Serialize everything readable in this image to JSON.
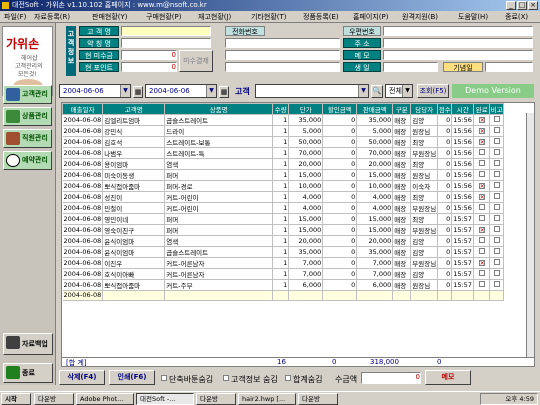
{
  "window": {
    "title": "대전Soft - 가위손 v1.10.102 홈페이지 : www.m@nsoft.co.kr"
  },
  "menu": [
    "파일(F)",
    "자료등록(R)",
    "판매현황(Y)",
    "구매현황(P)",
    "재고현황(J)",
    "기타현황(T)",
    "정품등록(E)",
    "홈페이지(P)",
    "원격지원(B)",
    "도움말(H)",
    "종료(X)"
  ],
  "sidebar": {
    "logo_title": "가위손",
    "logo_sub1": "헤어샵",
    "logo_sub2": "고객관리의",
    "logo_sub3": "모든것!",
    "items": [
      "고객관리",
      "상품관리",
      "직원관리",
      "예약관리"
    ],
    "backup": "자료백업",
    "exit": "종료"
  },
  "customer_panel": {
    "section_label": "고객정보",
    "labels": [
      "고 객 명",
      "약 칭 명",
      "현 미수금",
      "현 포인트"
    ],
    "values": [
      "",
      "",
      "0",
      "0"
    ],
    "settle_button": "미수결제",
    "phone_label": "전화번호",
    "right_labels": [
      "우편번호",
      "주 소",
      "메 모",
      "생 일"
    ],
    "anniv_label": "기념일"
  },
  "toolbar": {
    "date_from": "2004-06-06",
    "date_to": "2004-06-06",
    "customer_label": "고객",
    "customer_value": "",
    "filter_value": "전체",
    "search_button": "조회(F5)",
    "demo": "Demo Version"
  },
  "table": {
    "columns": [
      "매출일자",
      "고객명",
      "상품명",
      "수량",
      "단가",
      "할인금액",
      "판매금액",
      "구분",
      "담당자",
      "점수",
      "시간",
      "완료",
      "비고"
    ],
    "rows": [
      [
        "2004-06-08",
        "김엘리트엄마",
        "곱슬스트레이트",
        "1",
        "35,000",
        "0",
        "35,000",
        "매장",
        "김양",
        "0",
        "15:56",
        "x",
        ""
      ],
      [
        "2004-06-08",
        "강민식",
        "드라이",
        "1",
        "5,000",
        "0",
        "5,000",
        "매장",
        "원장님",
        "0",
        "15:56",
        "x",
        ""
      ],
      [
        "2004-06-08",
        "김호석",
        "스트레이트-보통",
        "1",
        "50,000",
        "0",
        "50,000",
        "매장",
        "최양",
        "0",
        "15:56",
        "x",
        ""
      ],
      [
        "2004-06-08",
        "나범우",
        "스트레이트-특",
        "1",
        "70,000",
        "0",
        "70,000",
        "매장",
        "부원장님",
        "0",
        "15:56",
        "",
        ""
      ],
      [
        "2004-06-08",
        "용이엄마",
        "염색",
        "1",
        "20,000",
        "0",
        "20,000",
        "매장",
        "최양",
        "0",
        "15:56",
        "",
        ""
      ],
      [
        "2004-06-08",
        "미숙이동생",
        "퍼머",
        "1",
        "15,000",
        "0",
        "15,000",
        "매장",
        "원장님",
        "0",
        "15:56",
        "",
        ""
      ],
      [
        "2004-06-08",
        "뽀식접아줌마",
        "퍼머-경로",
        "1",
        "10,000",
        "0",
        "10,000",
        "매장",
        "이숙자",
        "0",
        "15:56",
        "x",
        ""
      ],
      [
        "2004-06-08",
        "성진이",
        "커트-어린이",
        "1",
        "4,000",
        "0",
        "4,000",
        "매장",
        "최양",
        "0",
        "15:56",
        "x",
        ""
      ],
      [
        "2004-06-08",
        "민철이",
        "커트-어린이",
        "1",
        "4,000",
        "0",
        "4,000",
        "매장",
        "부원장님",
        "0",
        "15:56",
        "",
        ""
      ],
      [
        "2004-06-08",
        "영민이네",
        "퍼머",
        "1",
        "15,000",
        "0",
        "15,000",
        "매장",
        "최양",
        "0",
        "15:57",
        "",
        ""
      ],
      [
        "2004-06-08",
        "영숙이친구",
        "퍼머",
        "1",
        "15,000",
        "0",
        "15,000",
        "매장",
        "부원장님",
        "0",
        "15:57",
        "x",
        ""
      ],
      [
        "2004-06-08",
        "윤식이엄마",
        "염색",
        "1",
        "20,000",
        "0",
        "20,000",
        "매장",
        "김양",
        "0",
        "15:57",
        "",
        ""
      ],
      [
        "2004-06-08",
        "윤식이엄마",
        "곱슬스트레이트",
        "1",
        "35,000",
        "0",
        "35,000",
        "매장",
        "김양",
        "0",
        "15:57",
        "",
        ""
      ],
      [
        "2004-06-08",
        "이진우",
        "커트-어른남자",
        "1",
        "7,000",
        "0",
        "7,000",
        "매장",
        "부원장님",
        "0",
        "15:57",
        "x",
        ""
      ],
      [
        "2004-06-08",
        "호식이아빠",
        "커트-어른남자",
        "1",
        "7,000",
        "0",
        "7,000",
        "매장",
        "김양",
        "0",
        "15:57",
        "",
        ""
      ],
      [
        "2004-06-08",
        "뽀식접아줌마",
        "커트-주부",
        "1",
        "6,000",
        "0",
        "6,000",
        "매장",
        "원장님",
        "0",
        "15:57",
        "",
        ""
      ],
      [
        "2004-06-08",
        "",
        "",
        "",
        "",
        "",
        "",
        "",
        "",
        "",
        "",
        "",
        ""
      ]
    ]
  },
  "totals": {
    "label": "[합 계]",
    "qty": "16",
    "discount": "0",
    "sales": "318,000",
    "points": "0"
  },
  "bottom": {
    "delete_button": "삭제(F4)",
    "print_button": "인쇄(F6)",
    "opt1": "단축바툰숨김",
    "opt2": "고객정보 숨김",
    "opt3": "합계숨김",
    "received_label": "수금액",
    "received_value": "0",
    "memo_button": "메모"
  },
  "taskbar": {
    "start": "시작",
    "tasks": [
      "다운방",
      "Adobe Phot...",
      "대전Soft -...",
      "다운방",
      "hair2.hwp [...",
      "다운방"
    ],
    "clock": "오후 4:59"
  }
}
